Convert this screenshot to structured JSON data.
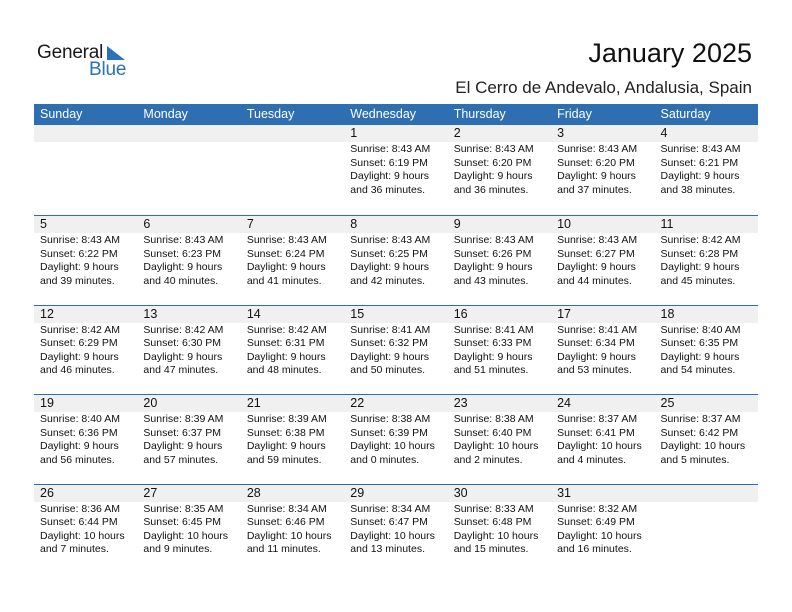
{
  "logo": {
    "line1": "General",
    "line2": "Blue"
  },
  "header": {
    "title": "January 2025",
    "location": "El Cerro de Andevalo, Andalusia, Spain"
  },
  "colors": {
    "accent": "#2e6fb1",
    "day_number_bg": "#f0f0f0"
  },
  "weekdays": [
    "Sunday",
    "Monday",
    "Tuesday",
    "Wednesday",
    "Thursday",
    "Friday",
    "Saturday"
  ],
  "weeks": [
    [
      null,
      null,
      null,
      {
        "day": "1",
        "sunrise": "Sunrise: 8:43 AM",
        "sunset": "Sunset: 6:19 PM",
        "daylight1": "Daylight: 9 hours",
        "daylight2": "and 36 minutes."
      },
      {
        "day": "2",
        "sunrise": "Sunrise: 8:43 AM",
        "sunset": "Sunset: 6:20 PM",
        "daylight1": "Daylight: 9 hours",
        "daylight2": "and 36 minutes."
      },
      {
        "day": "3",
        "sunrise": "Sunrise: 8:43 AM",
        "sunset": "Sunset: 6:20 PM",
        "daylight1": "Daylight: 9 hours",
        "daylight2": "and 37 minutes."
      },
      {
        "day": "4",
        "sunrise": "Sunrise: 8:43 AM",
        "sunset": "Sunset: 6:21 PM",
        "daylight1": "Daylight: 9 hours",
        "daylight2": "and 38 minutes."
      }
    ],
    [
      {
        "day": "5",
        "sunrise": "Sunrise: 8:43 AM",
        "sunset": "Sunset: 6:22 PM",
        "daylight1": "Daylight: 9 hours",
        "daylight2": "and 39 minutes."
      },
      {
        "day": "6",
        "sunrise": "Sunrise: 8:43 AM",
        "sunset": "Sunset: 6:23 PM",
        "daylight1": "Daylight: 9 hours",
        "daylight2": "and 40 minutes."
      },
      {
        "day": "7",
        "sunrise": "Sunrise: 8:43 AM",
        "sunset": "Sunset: 6:24 PM",
        "daylight1": "Daylight: 9 hours",
        "daylight2": "and 41 minutes."
      },
      {
        "day": "8",
        "sunrise": "Sunrise: 8:43 AM",
        "sunset": "Sunset: 6:25 PM",
        "daylight1": "Daylight: 9 hours",
        "daylight2": "and 42 minutes."
      },
      {
        "day": "9",
        "sunrise": "Sunrise: 8:43 AM",
        "sunset": "Sunset: 6:26 PM",
        "daylight1": "Daylight: 9 hours",
        "daylight2": "and 43 minutes."
      },
      {
        "day": "10",
        "sunrise": "Sunrise: 8:43 AM",
        "sunset": "Sunset: 6:27 PM",
        "daylight1": "Daylight: 9 hours",
        "daylight2": "and 44 minutes."
      },
      {
        "day": "11",
        "sunrise": "Sunrise: 8:42 AM",
        "sunset": "Sunset: 6:28 PM",
        "daylight1": "Daylight: 9 hours",
        "daylight2": "and 45 minutes."
      }
    ],
    [
      {
        "day": "12",
        "sunrise": "Sunrise: 8:42 AM",
        "sunset": "Sunset: 6:29 PM",
        "daylight1": "Daylight: 9 hours",
        "daylight2": "and 46 minutes."
      },
      {
        "day": "13",
        "sunrise": "Sunrise: 8:42 AM",
        "sunset": "Sunset: 6:30 PM",
        "daylight1": "Daylight: 9 hours",
        "daylight2": "and 47 minutes."
      },
      {
        "day": "14",
        "sunrise": "Sunrise: 8:42 AM",
        "sunset": "Sunset: 6:31 PM",
        "daylight1": "Daylight: 9 hours",
        "daylight2": "and 48 minutes."
      },
      {
        "day": "15",
        "sunrise": "Sunrise: 8:41 AM",
        "sunset": "Sunset: 6:32 PM",
        "daylight1": "Daylight: 9 hours",
        "daylight2": "and 50 minutes."
      },
      {
        "day": "16",
        "sunrise": "Sunrise: 8:41 AM",
        "sunset": "Sunset: 6:33 PM",
        "daylight1": "Daylight: 9 hours",
        "daylight2": "and 51 minutes."
      },
      {
        "day": "17",
        "sunrise": "Sunrise: 8:41 AM",
        "sunset": "Sunset: 6:34 PM",
        "daylight1": "Daylight: 9 hours",
        "daylight2": "and 53 minutes."
      },
      {
        "day": "18",
        "sunrise": "Sunrise: 8:40 AM",
        "sunset": "Sunset: 6:35 PM",
        "daylight1": "Daylight: 9 hours",
        "daylight2": "and 54 minutes."
      }
    ],
    [
      {
        "day": "19",
        "sunrise": "Sunrise: 8:40 AM",
        "sunset": "Sunset: 6:36 PM",
        "daylight1": "Daylight: 9 hours",
        "daylight2": "and 56 minutes."
      },
      {
        "day": "20",
        "sunrise": "Sunrise: 8:39 AM",
        "sunset": "Sunset: 6:37 PM",
        "daylight1": "Daylight: 9 hours",
        "daylight2": "and 57 minutes."
      },
      {
        "day": "21",
        "sunrise": "Sunrise: 8:39 AM",
        "sunset": "Sunset: 6:38 PM",
        "daylight1": "Daylight: 9 hours",
        "daylight2": "and 59 minutes."
      },
      {
        "day": "22",
        "sunrise": "Sunrise: 8:38 AM",
        "sunset": "Sunset: 6:39 PM",
        "daylight1": "Daylight: 10 hours",
        "daylight2": "and 0 minutes."
      },
      {
        "day": "23",
        "sunrise": "Sunrise: 8:38 AM",
        "sunset": "Sunset: 6:40 PM",
        "daylight1": "Daylight: 10 hours",
        "daylight2": "and 2 minutes."
      },
      {
        "day": "24",
        "sunrise": "Sunrise: 8:37 AM",
        "sunset": "Sunset: 6:41 PM",
        "daylight1": "Daylight: 10 hours",
        "daylight2": "and 4 minutes."
      },
      {
        "day": "25",
        "sunrise": "Sunrise: 8:37 AM",
        "sunset": "Sunset: 6:42 PM",
        "daylight1": "Daylight: 10 hours",
        "daylight2": "and 5 minutes."
      }
    ],
    [
      {
        "day": "26",
        "sunrise": "Sunrise: 8:36 AM",
        "sunset": "Sunset: 6:44 PM",
        "daylight1": "Daylight: 10 hours",
        "daylight2": "and 7 minutes."
      },
      {
        "day": "27",
        "sunrise": "Sunrise: 8:35 AM",
        "sunset": "Sunset: 6:45 PM",
        "daylight1": "Daylight: 10 hours",
        "daylight2": "and 9 minutes."
      },
      {
        "day": "28",
        "sunrise": "Sunrise: 8:34 AM",
        "sunset": "Sunset: 6:46 PM",
        "daylight1": "Daylight: 10 hours",
        "daylight2": "and 11 minutes."
      },
      {
        "day": "29",
        "sunrise": "Sunrise: 8:34 AM",
        "sunset": "Sunset: 6:47 PM",
        "daylight1": "Daylight: 10 hours",
        "daylight2": "and 13 minutes."
      },
      {
        "day": "30",
        "sunrise": "Sunrise: 8:33 AM",
        "sunset": "Sunset: 6:48 PM",
        "daylight1": "Daylight: 10 hours",
        "daylight2": "and 15 minutes."
      },
      {
        "day": "31",
        "sunrise": "Sunrise: 8:32 AM",
        "sunset": "Sunset: 6:49 PM",
        "daylight1": "Daylight: 10 hours",
        "daylight2": "and 16 minutes."
      },
      null
    ]
  ]
}
